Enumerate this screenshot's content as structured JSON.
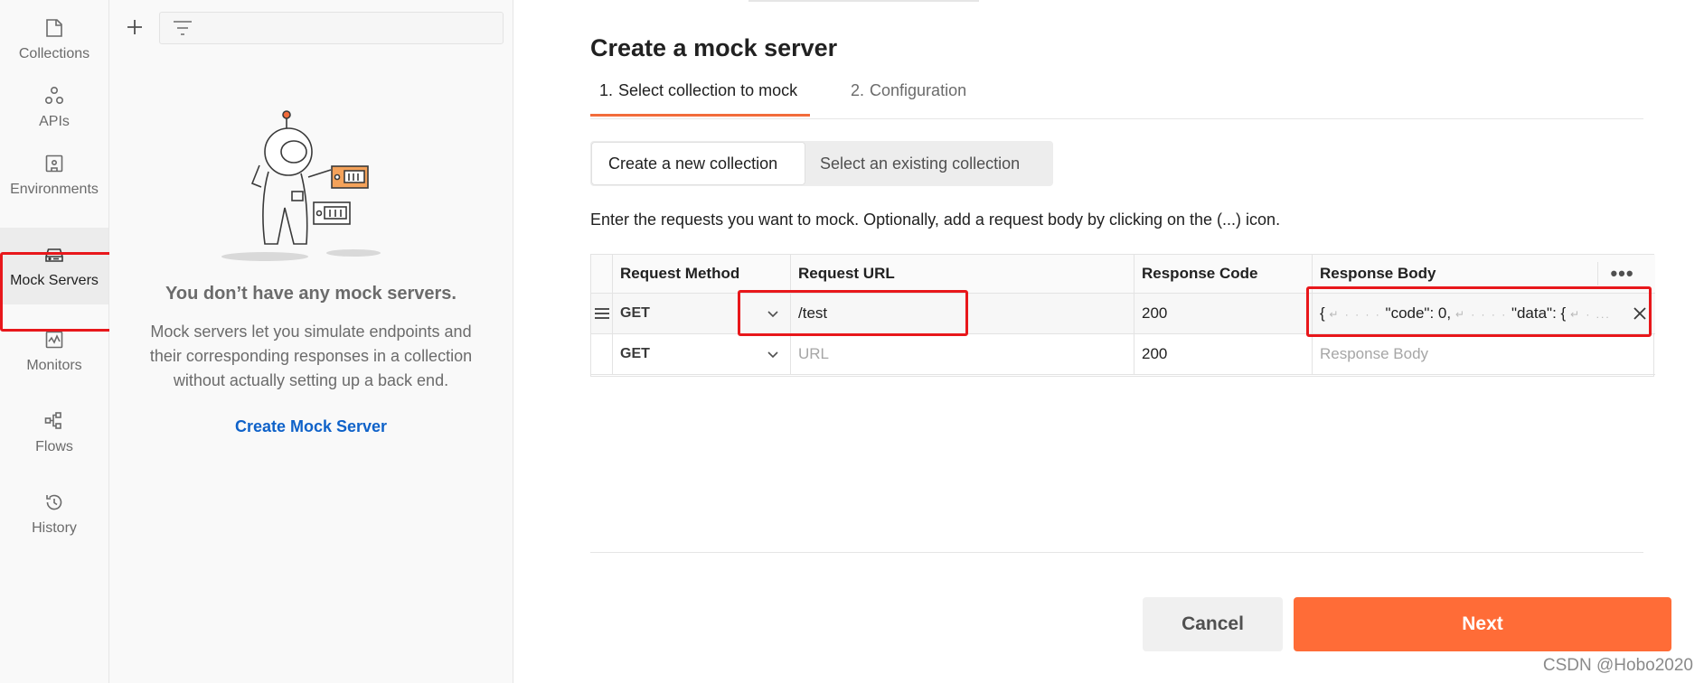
{
  "sidebar": {
    "items": [
      {
        "label": "Collections",
        "icon": "collections-icon"
      },
      {
        "label": "APIs",
        "icon": "apis-icon"
      },
      {
        "label": "Environments",
        "icon": "environments-icon"
      },
      {
        "label": "Mock Servers",
        "icon": "mock-servers-icon",
        "active": true
      },
      {
        "label": "Monitors",
        "icon": "monitors-icon"
      },
      {
        "label": "Flows",
        "icon": "flows-icon"
      },
      {
        "label": "History",
        "icon": "history-icon"
      }
    ]
  },
  "panel": {
    "empty_title": "You don’t have any mock servers.",
    "empty_description": "Mock servers let you simulate endpoints and their corresponding responses in a collection without actually setting up a back end.",
    "create_link": "Create Mock Server"
  },
  "main": {
    "title": "Create a mock server",
    "steps": [
      {
        "num": "1.",
        "label": "Select collection to mock",
        "active": true
      },
      {
        "num": "2.",
        "label": "Configuration",
        "active": false
      }
    ],
    "segment": {
      "new_label": "Create a new collection",
      "existing_label": "Select an existing collection",
      "selected": "new"
    },
    "instruction": "Enter the requests you want to mock. Optionally, add a request body by clicking on the (...) icon.",
    "table": {
      "headers": [
        "Request Method",
        "Request URL",
        "Response Code",
        "Response Body"
      ],
      "more_label": "•••",
      "rows": [
        {
          "method": "GET",
          "url": "/test",
          "url_placeholder": "URL",
          "code": "200",
          "body_parts": [
            "{",
            "↵ · · · ·",
            "\"code\": 0,",
            "↵ · · · ·",
            "\"data\": {",
            "↵ · ...",
            ""
          ],
          "body_placeholder": "Response Body"
        },
        {
          "method": "GET",
          "url": "",
          "url_placeholder": "URL",
          "code": "200",
          "body": "",
          "body_placeholder": "Response Body"
        }
      ]
    },
    "cancel_label": "Cancel",
    "next_label": "Next"
  },
  "watermark": "CSDN @Hobo2020",
  "colors": {
    "accent": "#ff6c37",
    "link": "#0f62c9",
    "highlight_box": "#e8171b"
  }
}
